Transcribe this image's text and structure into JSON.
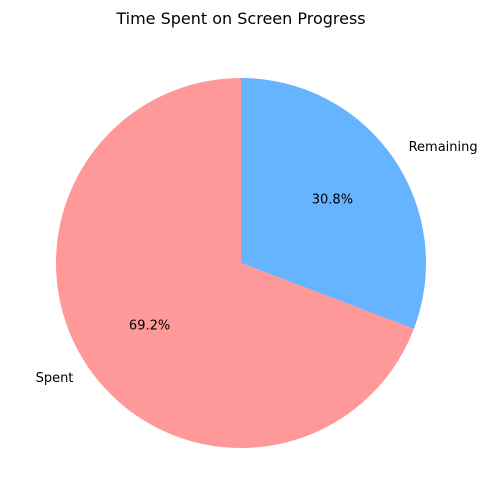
{
  "chart_data": {
    "type": "pie",
    "title": "Time Spent on Screen Progress",
    "slices": [
      {
        "label": "Remaining",
        "value": 30.8,
        "pct_label": "30.8%",
        "color": "#66b3ff"
      },
      {
        "label": "Spent",
        "value": 69.2,
        "pct_label": "69.2%",
        "color": "#ff9999"
      }
    ],
    "start_angle_deg": 90,
    "direction": "clockwise"
  }
}
